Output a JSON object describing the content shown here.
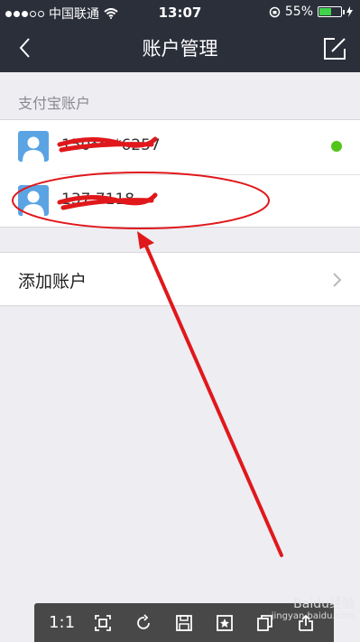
{
  "status_bar": {
    "carrier": "中国联通",
    "time": "13:07",
    "battery_percent": "55%",
    "battery_level": 0.55
  },
  "nav": {
    "title": "账户管理",
    "back_icon": "chevron-left-icon",
    "edit_icon": "edit-icon"
  },
  "section": {
    "header": "支付宝账户"
  },
  "accounts": [
    {
      "label": "150****6257",
      "avatar_icon": "user-avatar-icon",
      "active": true
    },
    {
      "label": "137     7118",
      "avatar_icon": "user-avatar-icon",
      "active": false
    }
  ],
  "add_account": {
    "label": "添加账户",
    "icon": "chevron-right-icon"
  },
  "viewer_toolbar": {
    "actual_size_label": "1:1",
    "icons": [
      "fit-screen-icon",
      "rotate-icon",
      "save-icon",
      "bookmark-icon",
      "copy-icon",
      "share-icon"
    ]
  },
  "watermark": {
    "title": "Baidu经验",
    "url": "jingyan.baidu.com"
  },
  "colors": {
    "nav_bg": "#2b2f3a",
    "page_bg": "#ededf2",
    "avatar": "#5aa4e4",
    "active_dot": "#52c41a",
    "annotation": "#e0181b"
  }
}
